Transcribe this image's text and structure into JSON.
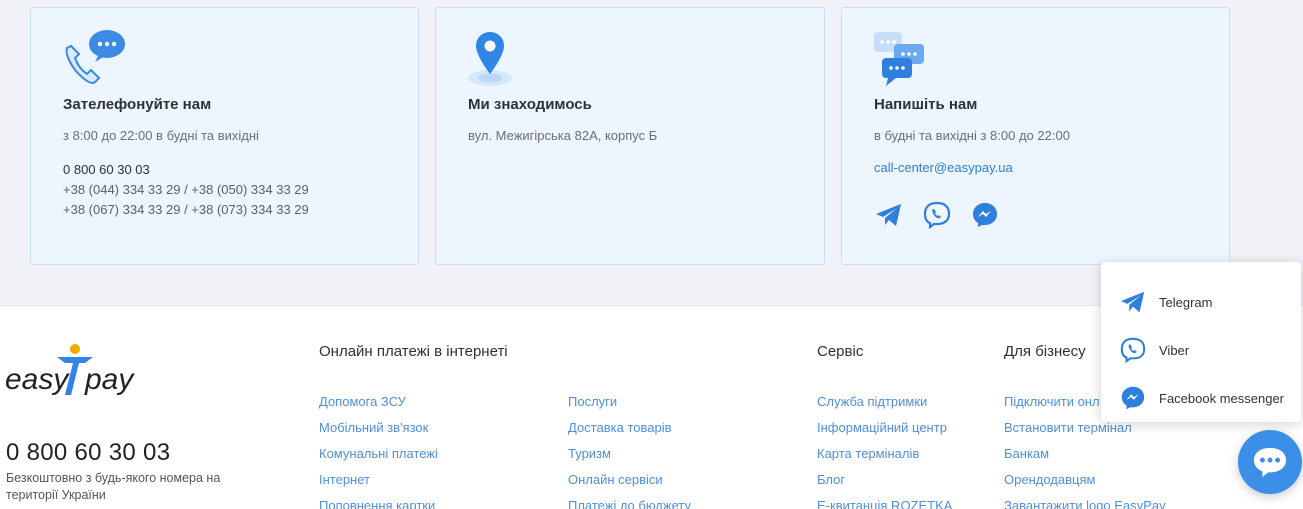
{
  "contacts": {
    "call": {
      "icon": "phone-chat-icon",
      "title": "Зателефонуйте нам",
      "hours": "з 8:00 до 22:00 в будні та вихідні",
      "main_phone": "0 800 60 30 03",
      "phones_line1": "+38 (044) 334 33 29 / +38 (050) 334 33 29",
      "phones_line2": "+38 (067) 334 33 29 / +38 (073) 334 33 29"
    },
    "location": {
      "icon": "map-pin-icon",
      "title": "Ми знаходимось",
      "address": "вул. Межигірська 82А, корпус Б"
    },
    "write": {
      "icon": "chat-bubbles-icon",
      "title": "Напишіть нам",
      "hours": "в будні та вихідні з 8:00 до 22:00",
      "email": "call-center@easypay.ua",
      "social_icons": [
        "telegram-icon",
        "viber-icon",
        "messenger-icon"
      ]
    }
  },
  "footer": {
    "logo_text": "easypay",
    "phone": "0 800 60 30 03",
    "phone_note": "Безкоштовно з будь-якого номера на території України",
    "online_payments": {
      "title": "Онлайн платежі в інтернеті",
      "col1": [
        "Допомога ЗСУ",
        "Мобільний зв'язок",
        "Комунальні платежі",
        "Інтернет",
        "Поповнення картки"
      ],
      "col2": [
        "Послуги",
        "Доставка товарів",
        "Туризм",
        "Онлайн сервіси",
        "Платежі до бюджету"
      ]
    },
    "service": {
      "title": "Сервіс",
      "links": [
        "Служба підтримки",
        "Інформаційний центр",
        "Карта терміналів",
        "Блог",
        "Е-квитанція ROZETKA"
      ]
    },
    "business": {
      "title": "Для бізнесу",
      "links": [
        "Підключити онл",
        "Встановити термінал",
        "Банкам",
        "Орендодавцям",
        "Завантажити logo EasyPay"
      ]
    }
  },
  "chat_popup": {
    "items": [
      {
        "label": "Telegram",
        "icon": "telegram-icon"
      },
      {
        "label": "Viber",
        "icon": "viber-icon"
      },
      {
        "label": "Facebook messenger",
        "icon": "messenger-icon"
      }
    ]
  },
  "colors": {
    "accent": "#2f7fdc",
    "link": "#4f8fdd",
    "card_bg": "#edf5fe",
    "fab": "#3b8fe8"
  }
}
